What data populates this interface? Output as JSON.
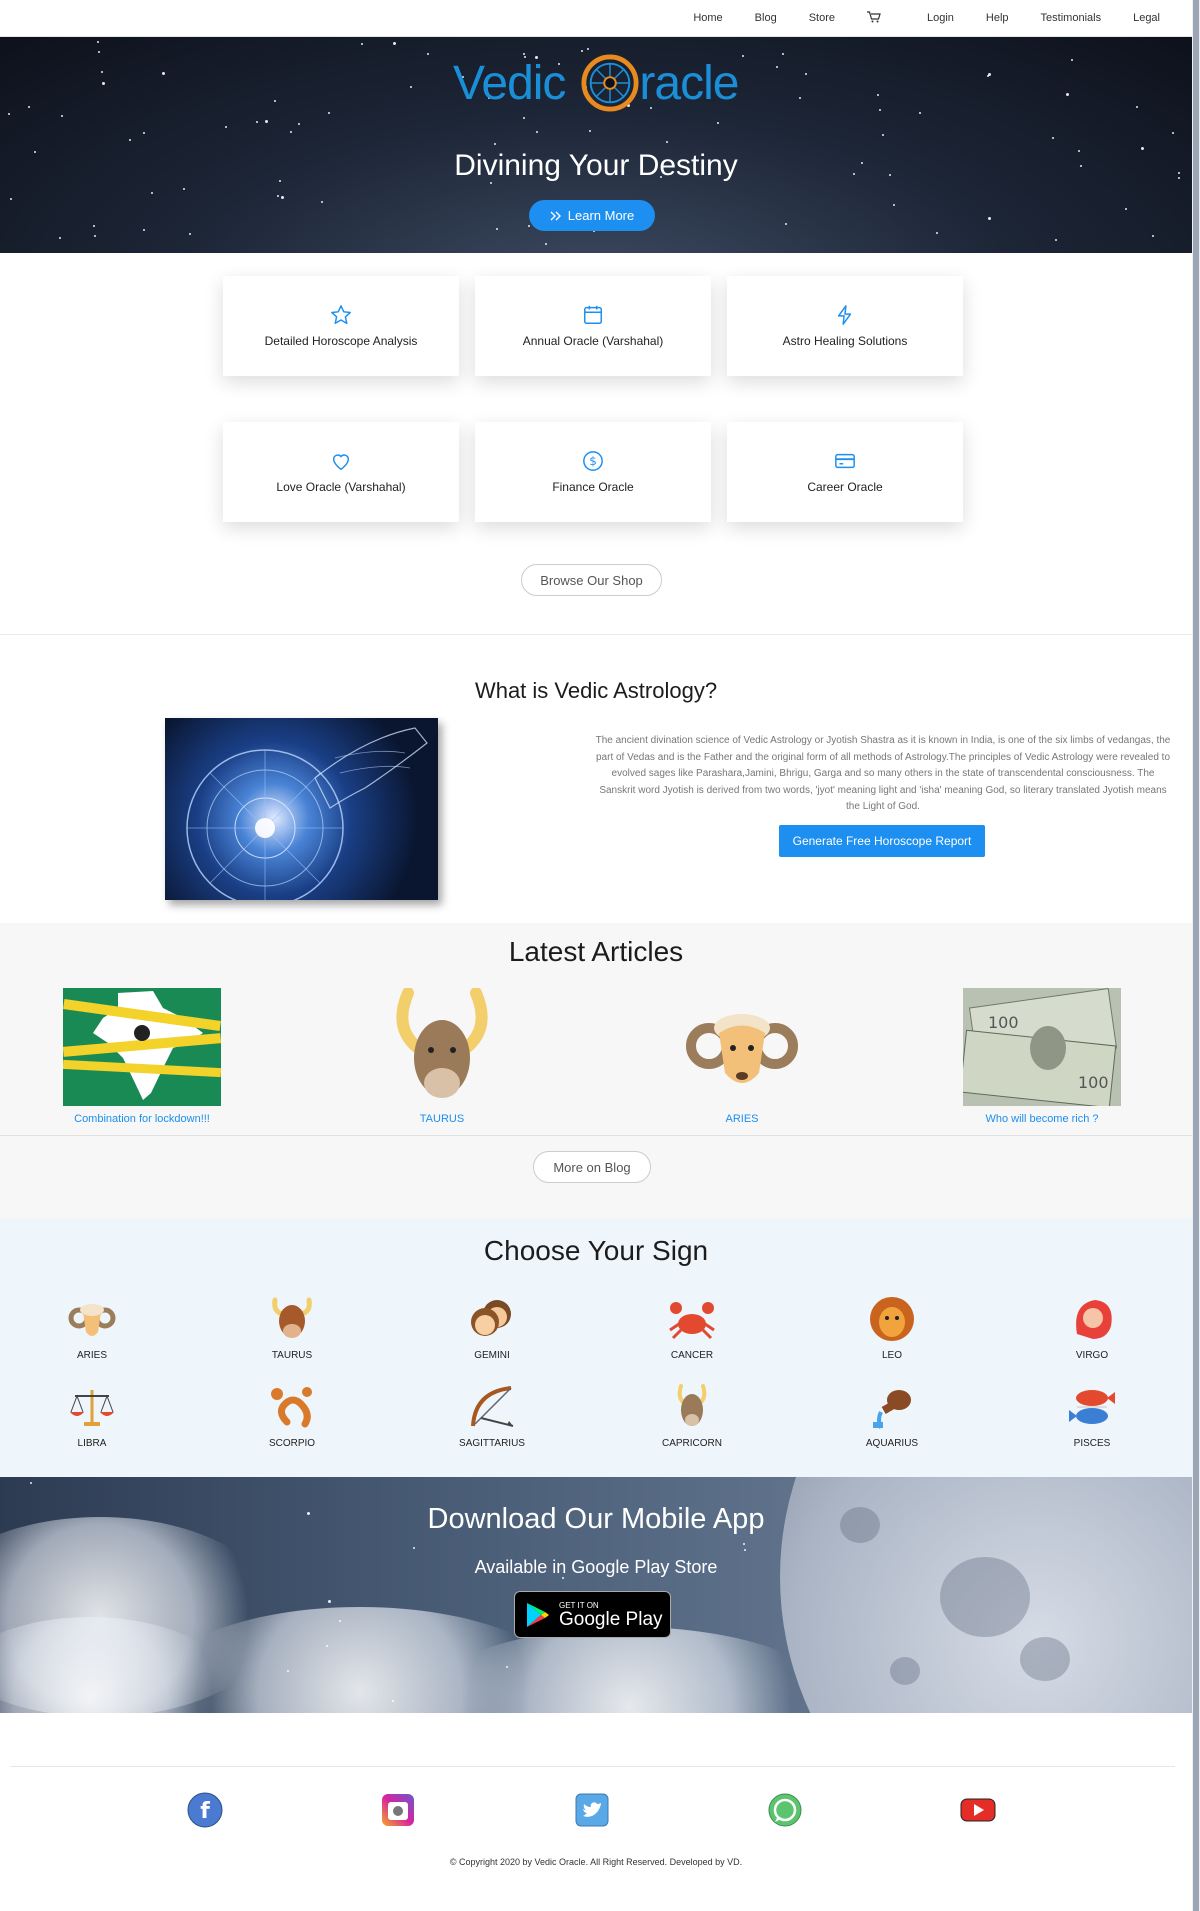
{
  "nav": {
    "items": [
      "Home",
      "Blog",
      "Store",
      "Login",
      "Help",
      "Testimonials",
      "Legal"
    ]
  },
  "brand": {
    "logo_left": "Vedic",
    "logo_right": "racle",
    "color": "#1a8fd8"
  },
  "hero": {
    "title": "Divining Your Destiny",
    "button_label": "Learn More"
  },
  "services": [
    {
      "label": "Detailed Horoscope Analysis",
      "icon": "star-icon"
    },
    {
      "label": "Annual Oracle (Varshahal)",
      "icon": "calendar-icon"
    },
    {
      "label": "Astro Healing Solutions",
      "icon": "lightning-icon"
    },
    {
      "label": "Love Oracle (Varshahal)",
      "icon": "heart-icon"
    },
    {
      "label": "Finance Oracle",
      "icon": "dollar-icon"
    },
    {
      "label": "Career Oracle",
      "icon": "credit-card-icon"
    }
  ],
  "shop": {
    "button_label": "Browse Our Shop"
  },
  "about": {
    "title": "What is Vedic Astrology?",
    "text": "The ancient divination science of Vedic Astrology or Jyotish Shastra as it is known in India, is one of the six limbs of vedangas, the part of Vedas and is the Father and the original form of all methods of Astrology.The principles of Vedic Astrology were revealed to evolved sages like Parashara,Jamini, Bhrigu, Garga and so many others in the state of transcendental consciousness. The Sanskrit word Jyotish is derived from two words, 'jyot' meaning light and 'isha' meaning God, so literary translated Jyotish means the Light of God.",
    "button_label": "Generate Free Horoscope Report"
  },
  "articles": {
    "title": "Latest Articles",
    "items": [
      {
        "label": "Combination for lockdown!!!"
      },
      {
        "label": "TAURUS"
      },
      {
        "label": "ARIES"
      },
      {
        "label": "Who will become rich ?"
      }
    ],
    "more_label": "More on Blog"
  },
  "signs": {
    "title": "Choose Your Sign",
    "items": [
      "ARIES",
      "TAURUS",
      "GEMINI",
      "CANCER",
      "LEO",
      "VIRGO",
      "LIBRA",
      "SCORPIO",
      "SAGITTARIUS",
      "CAPRICORN",
      "AQUARIUS",
      "PISCES"
    ]
  },
  "app": {
    "title": "Download Our Mobile App",
    "subtitle": "Available in Google Play Store",
    "badge_small": "GET IT ON",
    "badge_big": "Google Play"
  },
  "footer": {
    "social": [
      "facebook-icon",
      "instagram-icon",
      "twitter-icon",
      "whatsapp-icon",
      "youtube-icon"
    ],
    "copyright": "© Copyright 2020 by Vedic Oracle. All Right Reserved. Developed by VD."
  },
  "colors": {
    "accent": "#1c8ff0",
    "link": "#1c8ff0"
  }
}
